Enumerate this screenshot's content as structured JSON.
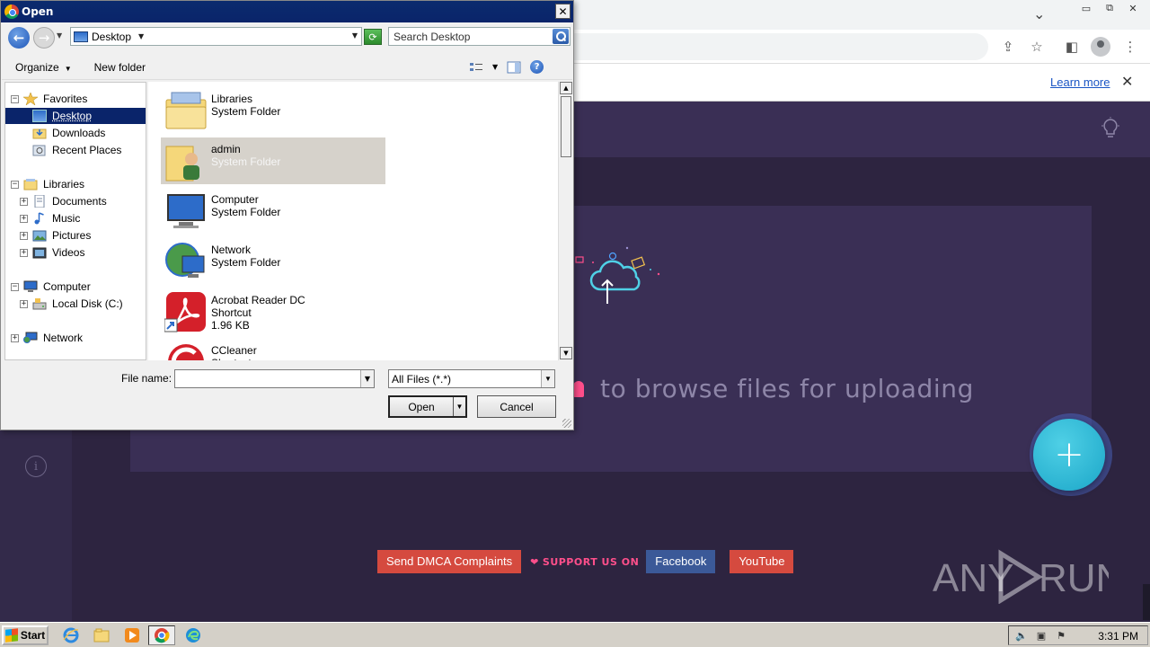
{
  "browser": {
    "infobar": {
      "learn_more": "Learn more"
    }
  },
  "site": {
    "upload_prompt": "to browse files for uploading",
    "footer": {
      "dmca": "Send DMCA Complaints",
      "support": "SUPPORT US ON",
      "facebook": "Facebook",
      "youtube": "YouTube"
    },
    "watermark": "ANY RUN"
  },
  "dialog": {
    "title": "Open",
    "address": "Desktop",
    "search_placeholder": "Search Desktop",
    "toolbar": {
      "organize": "Organize",
      "new_folder": "New folder"
    },
    "tree": {
      "favorites": "Favorites",
      "desktop": "Desktop",
      "downloads": "Downloads",
      "recent_places": "Recent Places",
      "libraries": "Libraries",
      "documents": "Documents",
      "music": "Music",
      "pictures": "Pictures",
      "videos": "Videos",
      "computer": "Computer",
      "local_disk": "Local Disk (C:)",
      "network": "Network"
    },
    "files": [
      {
        "name": "Libraries",
        "type": "System Folder"
      },
      {
        "name": "admin",
        "type": "System Folder"
      },
      {
        "name": "Computer",
        "type": "System Folder"
      },
      {
        "name": "Network",
        "type": "System Folder"
      },
      {
        "name": "Acrobat Reader DC",
        "type": "Shortcut",
        "size": "1.96 KB"
      },
      {
        "name": "CCleaner",
        "type": "Shortcut"
      }
    ],
    "file_name_label": "File name:",
    "file_name_value": "",
    "filter": "All Files (*.*)",
    "open_button": "Open",
    "cancel_button": "Cancel"
  },
  "taskbar": {
    "start": "Start",
    "clock": "3:31 PM"
  },
  "colors": {
    "site_bg": "#2d2440",
    "accent_pink": "#ff4f8b",
    "fab": "#1ba6c8",
    "selection": "#0a246a"
  }
}
